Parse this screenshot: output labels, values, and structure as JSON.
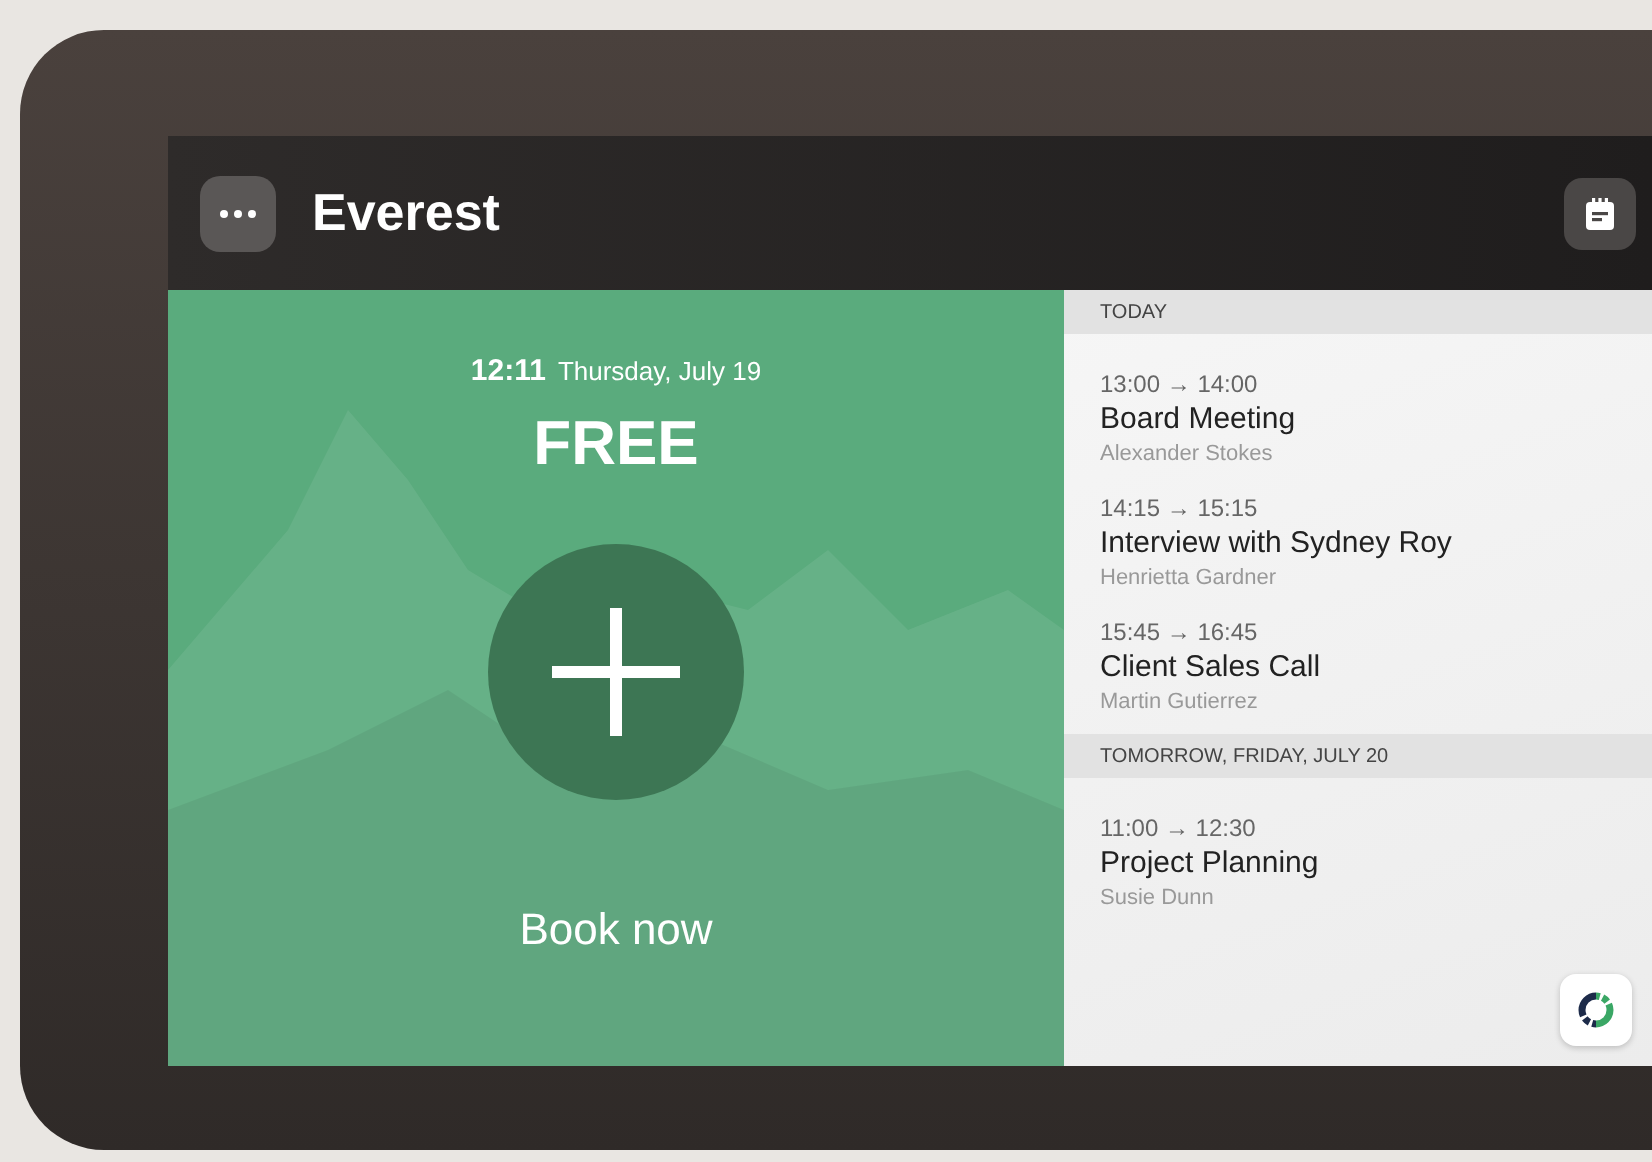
{
  "room": {
    "name": "Everest",
    "status": "FREE",
    "kind": "free",
    "time": "12:11",
    "date": "Thursday, July 19",
    "action": "Book now"
  },
  "agenda": [
    {
      "heading": "TODAY",
      "events": [
        {
          "time": "13:00 → 14:00",
          "title": "Board Meeting",
          "organizer": "Alexander Stokes"
        },
        {
          "time": "14:15 → 15:15",
          "title": "Interview with Sydney Roy",
          "organizer": "Henrietta Gardner"
        },
        {
          "time": "15:45 → 16:45",
          "title": "Client Sales Call",
          "organizer": "Martin Gutierrez"
        }
      ]
    },
    {
      "heading": "TOMORROW, FRIDAY, JULY 20",
      "events": [
        {
          "time": "11:00 → 12:30",
          "title": "Project Planning",
          "organizer": "Susie Dunn"
        }
      ]
    }
  ]
}
